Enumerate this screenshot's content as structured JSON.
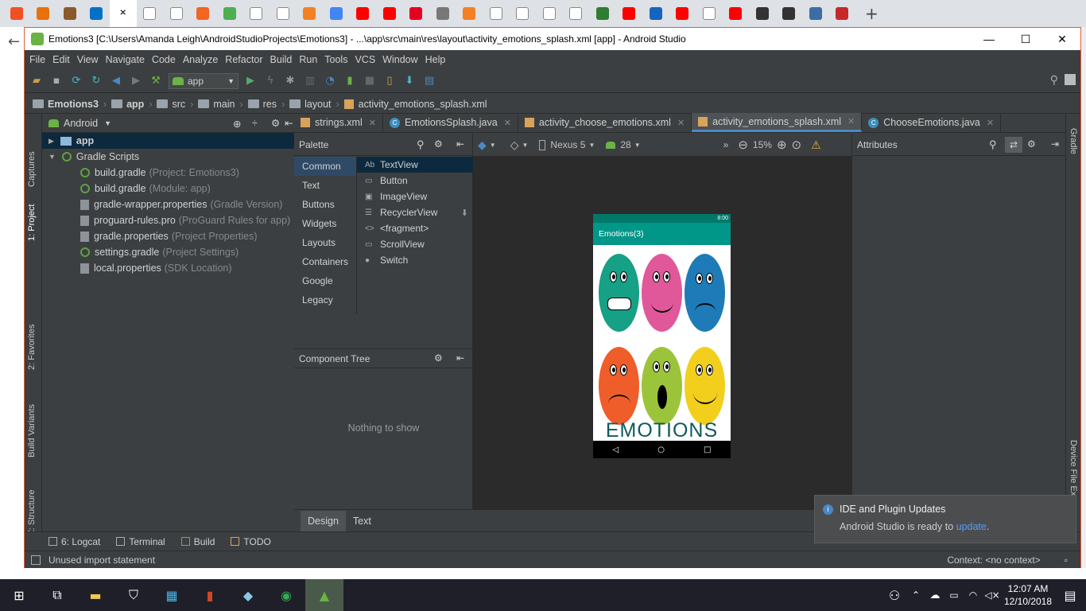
{
  "browser": {
    "tabs": [
      {
        "icon": "windows-icon",
        "color": "#f25022"
      },
      {
        "icon": "bookmark-icon",
        "color": "#e8710a"
      },
      {
        "icon": "k-icon",
        "color": "#8a5a2b"
      },
      {
        "icon": "outlook-icon",
        "color": "#0072c6"
      },
      {
        "icon": "close-tab-icon",
        "color": "#ffffff"
      },
      {
        "icon": "doc-icon",
        "color": "#888888"
      },
      {
        "icon": "doc-icon",
        "color": "#888888"
      },
      {
        "icon": "orange-circle-icon",
        "color": "#f26522"
      },
      {
        "icon": "w3-icon",
        "color": "#4caf50"
      },
      {
        "icon": "doc-icon",
        "color": "#888888"
      },
      {
        "icon": "doc-icon",
        "color": "#888888"
      },
      {
        "icon": "stackoverflow-icon",
        "color": "#f48024"
      },
      {
        "icon": "google-icon",
        "color": "#4285f4"
      },
      {
        "icon": "youtube-icon",
        "color": "#ff0000"
      },
      {
        "icon": "youtube-icon",
        "color": "#ff0000"
      },
      {
        "icon": "pinterest-icon",
        "color": "#e60023"
      },
      {
        "icon": "grid-icon",
        "color": "#777777"
      },
      {
        "icon": "stackoverflow-icon",
        "color": "#f48024"
      },
      {
        "icon": "doc-icon",
        "color": "#888888"
      },
      {
        "icon": "doc-icon",
        "color": "#888888"
      },
      {
        "icon": "doc-icon",
        "color": "#888888"
      },
      {
        "icon": "doc-icon",
        "color": "#888888"
      },
      {
        "icon": "shield-icon",
        "color": "#2e7d32"
      },
      {
        "icon": "youtube-icon",
        "color": "#ff0000"
      },
      {
        "icon": "triangle-icon",
        "color": "#1565c0"
      },
      {
        "icon": "youtube-icon",
        "color": "#ff0000"
      },
      {
        "icon": "doc-icon",
        "color": "#888888"
      },
      {
        "icon": "youtube-icon",
        "color": "#ff0000"
      },
      {
        "icon": "wikipedia-icon",
        "color": "#333333"
      },
      {
        "icon": "wikipedia-icon",
        "color": "#333333"
      },
      {
        "icon": "pt-icon",
        "color": "#3b6ea5"
      },
      {
        "icon": "new-icon",
        "color": "#c62828"
      }
    ],
    "new_tab": "+"
  },
  "window": {
    "title": "Emotions3 [C:\\Users\\Amanda Leigh\\AndroidStudioProjects\\Emotions3] - ...\\app\\src\\main\\res\\layout\\activity_emotions_splash.xml [app] - Android Studio",
    "minimize": "—",
    "maximize": "☐",
    "close": "✕"
  },
  "menu": [
    "File",
    "Edit",
    "View",
    "Navigate",
    "Code",
    "Analyze",
    "Refactor",
    "Build",
    "Run",
    "Tools",
    "VCS",
    "Window",
    "Help"
  ],
  "toolbar": {
    "config": "app"
  },
  "breadcrumb": [
    "Emotions3",
    "app",
    "src",
    "main",
    "res",
    "layout",
    "activity_emotions_splash.xml"
  ],
  "left_strip": {
    "captures": "Captures",
    "project": "1: Project",
    "favorites": "2: Favorites",
    "build_variants": "Build Variants",
    "structure": "Z: Structure"
  },
  "project": {
    "view": "Android",
    "items": [
      {
        "name": "app",
        "sub": "",
        "level": 0
      },
      {
        "name": "Gradle Scripts",
        "sub": "",
        "level": 0
      },
      {
        "name": "build.gradle",
        "sub": "(Project: Emotions3)",
        "level": 1
      },
      {
        "name": "build.gradle",
        "sub": "(Module: app)",
        "level": 1
      },
      {
        "name": "gradle-wrapper.properties",
        "sub": "(Gradle Version)",
        "level": 1
      },
      {
        "name": "proguard-rules.pro",
        "sub": "(ProGuard Rules for app)",
        "level": 1
      },
      {
        "name": "gradle.properties",
        "sub": "(Project Properties)",
        "level": 1
      },
      {
        "name": "settings.gradle",
        "sub": "(Project Settings)",
        "level": 1
      },
      {
        "name": "local.properties",
        "sub": "(SDK Location)",
        "level": 1
      }
    ]
  },
  "editor_tabs": [
    {
      "label": "strings.xml",
      "type": "xml"
    },
    {
      "label": "EmotionsSplash.java",
      "type": "java"
    },
    {
      "label": "activity_choose_emotions.xml",
      "type": "xml"
    },
    {
      "label": "activity_emotions_splash.xml",
      "type": "xml"
    },
    {
      "label": "ChooseEmotions.java",
      "type": "java"
    }
  ],
  "palette": {
    "title": "Palette",
    "categories": [
      "Common",
      "Text",
      "Buttons",
      "Widgets",
      "Layouts",
      "Containers",
      "Google",
      "Legacy"
    ],
    "items": [
      {
        "icon": "Ab",
        "label": "TextView"
      },
      {
        "icon": "▭",
        "label": "Button"
      },
      {
        "icon": "▣",
        "label": "ImageView"
      },
      {
        "icon": "☰",
        "label": "RecyclerView"
      },
      {
        "icon": "<>",
        "label": "<fragment>"
      },
      {
        "icon": "▭",
        "label": "ScrollView"
      },
      {
        "icon": "●",
        "label": "Switch"
      }
    ]
  },
  "component_tree": {
    "title": "Component Tree",
    "empty": "Nothing to show"
  },
  "canvas": {
    "device": "Nexus 5",
    "api": "28",
    "zoom": "15%"
  },
  "phone": {
    "app_title": "Emotions(3)",
    "time": "8:00",
    "banner": "EMOTIONS"
  },
  "attributes": {
    "title": "Attributes"
  },
  "right_strip": {
    "gradle": "Gradle",
    "device_file": "Device File Ex"
  },
  "design_tabs": [
    "Design",
    "Text"
  ],
  "bottom_tools": [
    {
      "icon": "logcat-icon",
      "label": "6: Logcat"
    },
    {
      "icon": "terminal-icon",
      "label": "Terminal"
    },
    {
      "icon": "build-icon",
      "label": "Build"
    },
    {
      "icon": "todo-icon",
      "label": "TODO"
    }
  ],
  "status": {
    "message": "Unused import statement",
    "context": "Context: <no context>"
  },
  "notification": {
    "title": "IDE and Plugin Updates",
    "body": "Android Studio is ready to",
    "link": "update",
    "end": "."
  },
  "taskbar": {
    "time": "12:07 AM",
    "date": "12/10/2018"
  }
}
